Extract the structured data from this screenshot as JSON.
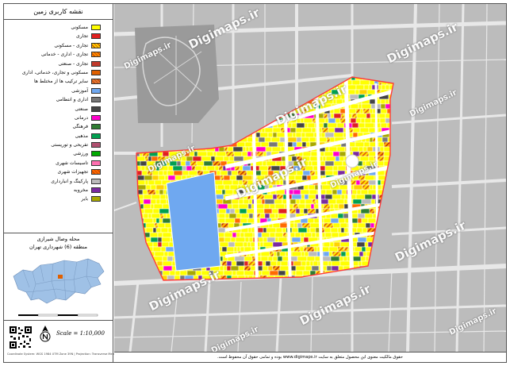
{
  "legend": {
    "title": "نقشه کاربری زمین",
    "items": [
      {
        "label": "مسکونی",
        "color": "#ffff00",
        "hatch": false
      },
      {
        "label": "تجاری",
        "color": "#e02020",
        "hatch": false
      },
      {
        "label": "تجاری - مسکونی",
        "color": "#ffd200",
        "hatch": true
      },
      {
        "label": "تجاری - اداری - خدماتی",
        "color": "#ff8c00",
        "hatch": true
      },
      {
        "label": "تجاری - صنعتی",
        "color": "#c0392b",
        "hatch": false
      },
      {
        "label": "مسکونی و تجاری، خدماتی، اداری",
        "color": "#e06000",
        "hatch": false
      },
      {
        "label": "سایر ترکیب ها از مختلط ها",
        "color": "#e07a3a",
        "hatch": true
      },
      {
        "label": "آموزشی",
        "color": "#6fa8f0",
        "hatch": false
      },
      {
        "label": "اداری و انتظامی",
        "color": "#777777",
        "hatch": false
      },
      {
        "label": "صنعتی",
        "color": "#444444",
        "hatch": false
      },
      {
        "label": "درمانی",
        "color": "#ff00cc",
        "hatch": false
      },
      {
        "label": "فرهنگی",
        "color": "#2e7d32",
        "hatch": false
      },
      {
        "label": "مذهبی",
        "color": "#00a050",
        "hatch": false
      },
      {
        "label": "تفریحی و توریستی",
        "color": "#b05070",
        "hatch": false
      },
      {
        "label": "ورزشی",
        "color": "#00aa00",
        "hatch": false
      },
      {
        "label": "تاسیسات شهری",
        "color": "#ff6fb0",
        "hatch": false
      },
      {
        "label": "تجهیزات شهری",
        "color": "#ff6a00",
        "hatch": true
      },
      {
        "label": "پارکینگ و انبارداری",
        "color": "#bbbbbb",
        "hatch": false
      },
      {
        "label": "مخروبه",
        "color": "#7a2aa0",
        "hatch": false
      },
      {
        "label": "بایر",
        "color": "#a8a800",
        "hatch": false
      }
    ]
  },
  "location": {
    "line1": "محله وصال شیرازی",
    "line2": "منطقه (6) شهرداری تهران"
  },
  "scale_label": "Scale = 1:10,000",
  "projection_label": "Coordinate System: WGS 1984 UTM Zone 39N | Projection: Transverse Mercator",
  "watermark": "Digimaps.ir",
  "footer_text": "حقوق مالکیت معنوی این محصول متعلق به سایت www.digimaps.ir بوده و تمامی حقوق آن محفوظ است.",
  "colors": {
    "boundary": "#ff3b3b",
    "street": "#ffffff",
    "background": "#bcbcbc",
    "water_region": "#9fc1e6"
  }
}
